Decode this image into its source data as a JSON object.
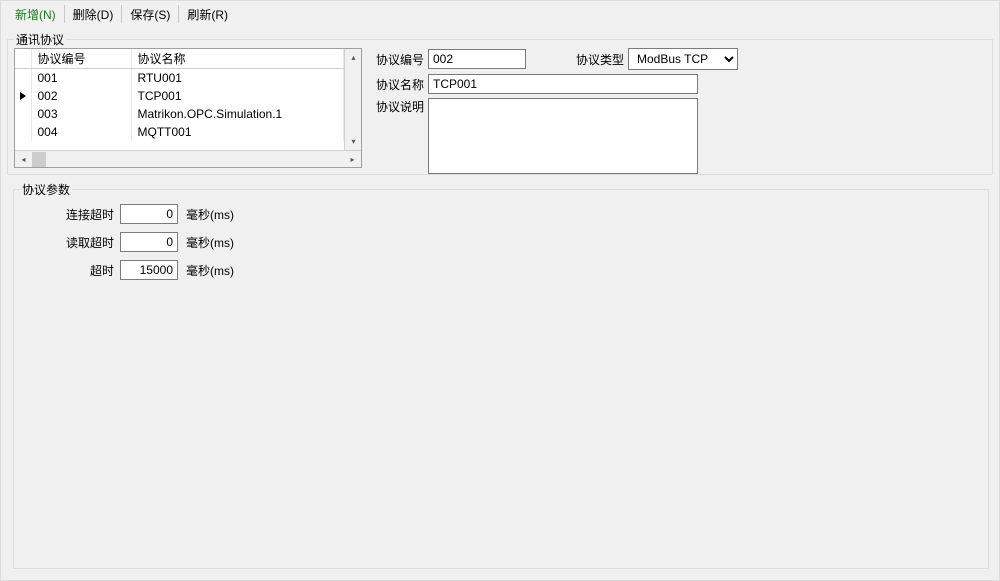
{
  "toolbar": {
    "new_label": "新增(N)",
    "delete_label": "删除(D)",
    "save_label": "保存(S)",
    "refresh_label": "刷新(R)"
  },
  "groups": {
    "protocols_title": "通讯协议",
    "params_title": "协议参数"
  },
  "grid": {
    "columns": {
      "id": "协议编号",
      "name": "协议名称"
    },
    "rows": [
      {
        "id": "001",
        "name": "RTU001",
        "selected": false
      },
      {
        "id": "002",
        "name": "TCP001",
        "selected": true
      },
      {
        "id": "003",
        "name": "Matrikon.OPC.Simulation.1",
        "selected": false
      },
      {
        "id": "004",
        "name": "MQTT001",
        "selected": false
      }
    ]
  },
  "form": {
    "labels": {
      "id": "协议编号",
      "type": "协议类型",
      "name": "协议名称",
      "desc": "协议说明"
    },
    "values": {
      "id": "002",
      "type": "ModBus TCP",
      "name": "TCP001",
      "desc": ""
    }
  },
  "params": {
    "labels": {
      "connect_timeout": "连接超时",
      "read_timeout": "读取超时",
      "timeout": "超时",
      "unit_ms": "毫秒(ms)"
    },
    "values": {
      "connect_timeout": "0",
      "read_timeout": "0",
      "timeout": "15000"
    }
  }
}
